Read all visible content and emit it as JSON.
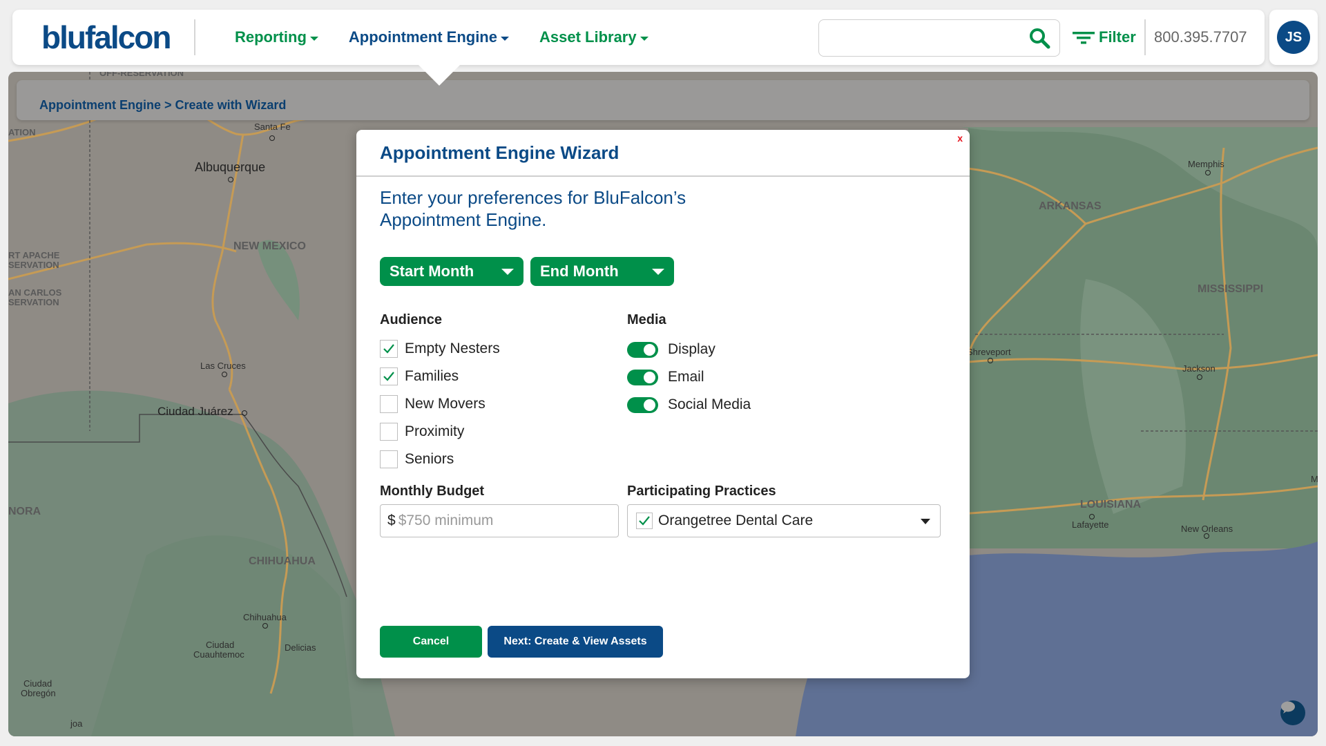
{
  "header": {
    "logo_text": "blufalcon",
    "nav": [
      {
        "label": "Reporting",
        "active": false
      },
      {
        "label": "Appointment Engine",
        "active": true
      },
      {
        "label": "Asset Library",
        "active": false
      }
    ],
    "search": {
      "value": "",
      "placeholder": ""
    },
    "filter_label": "Filter",
    "phone": "800.395.7707",
    "avatar_initials": "JS"
  },
  "breadcrumb": {
    "parent": "Appointment Engine",
    "separator": ">",
    "current": "Create with Wizard"
  },
  "map": {
    "labels": {
      "santa_fe": "Santa Fe",
      "albuquerque": "Albuquerque",
      "new_mexico": "NEW MEXICO",
      "fort_apache": "RT APACHE",
      "fort_apache_2": "SERVATION",
      "san_carlos": "AN CARLOS",
      "san_carlos_2": "SERVATION",
      "hopi": "ATION",
      "off_reservation": "OFF-RESERVATION",
      "las_cruces": "Las Cruces",
      "ciudad_juarez": "Ciudad Juárez",
      "sonora": "NORA",
      "chihuahua_state": "CHIHUAHUA",
      "chihuahua_city": "Chihuahua",
      "cuauhtemoc_1": "Ciudad",
      "cuauhtemoc_2": "Cuauhtemoc",
      "delicias": "Delicias",
      "obregon_1": "Ciudad",
      "obregon_2": "Obregón",
      "joa": "joa",
      "memphis": "Memphis",
      "arkansas": "ARKANSAS",
      "mississippi": "MISSISSIPPI",
      "shreveport": "Shreveport",
      "jackson": "Jackson",
      "louisiana": "LOUISIANA",
      "lafayette": "Lafayette",
      "new_orleans": "New Orleans",
      "m_edge": "M"
    }
  },
  "wizard": {
    "close_label": "x",
    "title": "Appointment Engine Wizard",
    "intro_line1": "Enter your preferences for BluFalcon’s",
    "intro_line2": "Appointment Engine.",
    "start_month_label": "Start Month",
    "end_month_label": "End Month",
    "audience": {
      "label": "Audience",
      "options": [
        {
          "label": "Empty Nesters",
          "checked": true
        },
        {
          "label": "Families",
          "checked": true
        },
        {
          "label": "New Movers",
          "checked": false
        },
        {
          "label": "Proximity",
          "checked": false
        },
        {
          "label": "Seniors",
          "checked": false
        }
      ]
    },
    "media": {
      "label": "Media",
      "options": [
        {
          "label": "Display",
          "on": true
        },
        {
          "label": "Email",
          "on": true
        },
        {
          "label": "Social Media",
          "on": true
        }
      ]
    },
    "budget": {
      "label": "Monthly Budget",
      "prefix": "$",
      "value": "",
      "placeholder": "$750 minimum"
    },
    "practices": {
      "label": "Participating Practices",
      "selected": "Orangetree Dental Care",
      "checked": true
    },
    "cancel_label": "Cancel",
    "next_label": "Next: Create & View Assets"
  },
  "colors": {
    "brand_blue": "#0b4a86",
    "brand_green": "#00904a",
    "close_red": "#e5121c"
  }
}
